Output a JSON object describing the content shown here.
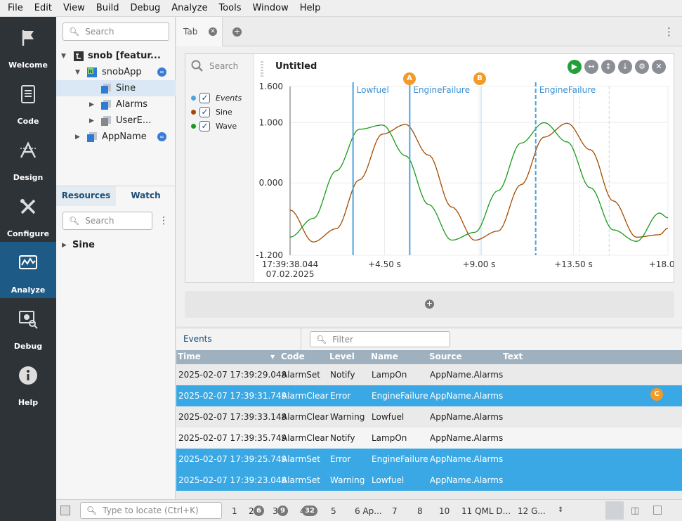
{
  "menu": [
    "File",
    "Edit",
    "View",
    "Build",
    "Debug",
    "Analyze",
    "Tools",
    "Window",
    "Help"
  ],
  "modes": [
    {
      "label": "Welcome",
      "icon": "flag-icon"
    },
    {
      "label": "Code",
      "icon": "document-icon"
    },
    {
      "label": "Design",
      "icon": "design-icon"
    },
    {
      "label": "Configure",
      "icon": "wrench-icon"
    },
    {
      "label": "Analyze",
      "icon": "analyze-icon",
      "active": true
    },
    {
      "label": "Debug",
      "icon": "debug-icon"
    },
    {
      "label": "Help",
      "icon": "info-icon"
    }
  ],
  "sidebar": {
    "search_placeholder": "Search",
    "tree": [
      {
        "label": "snob [featur...",
        "bold": true
      },
      {
        "label": "snobApp"
      },
      {
        "label": "Sine",
        "selected": true
      },
      {
        "label": "Alarms"
      },
      {
        "label": "UserE..."
      },
      {
        "label": "AppName"
      }
    ],
    "tabs": {
      "resources": "Resources",
      "watch": "Watch"
    },
    "resources_search_placeholder": "Search",
    "resources_item": "Sine"
  },
  "tabbar": {
    "tab_label": "Tab"
  },
  "plot": {
    "search_placeholder": "Search",
    "title": "Untitled",
    "legend": [
      {
        "label": "Events",
        "color": "#4aa3df"
      },
      {
        "label": "Sine",
        "color": "#a34b00"
      },
      {
        "label": "Wave",
        "color": "#1a9a1a"
      }
    ]
  },
  "chart_data": {
    "type": "line",
    "title": "Untitled",
    "y_ticks": [
      "1.600",
      "1.000",
      "0.000",
      "-1.200"
    ],
    "x_ticks": [
      "17:39:38.044",
      "+4.50 s",
      "+9.00 s",
      "+13.50 s",
      "+18.00 s"
    ],
    "x_start_date": "07.02.2025",
    "ylim": [
      -1.2,
      1.6
    ],
    "xlim": [
      0,
      18.0
    ],
    "series": [
      {
        "name": "Sine",
        "color": "#a34b00",
        "x": [
          0,
          1.1,
          2.2,
          3.3,
          4.4,
          5.5,
          6.6,
          7.7,
          8.8,
          9.9,
          11.0,
          12.1,
          13.2,
          14.3,
          15.4,
          16.5,
          17.6,
          18.0
        ],
        "y": [
          -0.45,
          -0.98,
          -0.76,
          0.05,
          0.81,
          0.97,
          0.46,
          -0.4,
          -0.95,
          -0.8,
          -0.03,
          0.76,
          0.99,
          0.55,
          -0.3,
          -0.9,
          -0.86,
          -0.75
        ]
      },
      {
        "name": "Wave",
        "color": "#1a9a1a",
        "x": [
          0,
          1.1,
          2.2,
          3.3,
          4.4,
          5.5,
          6.6,
          7.7,
          8.8,
          9.9,
          11.0,
          12.1,
          13.2,
          14.3,
          15.4,
          16.5,
          17.6,
          18.0
        ],
        "y": [
          -0.9,
          -0.59,
          0.2,
          0.89,
          0.96,
          0.45,
          -0.36,
          -0.95,
          -0.82,
          -0.13,
          0.66,
          1.0,
          0.68,
          -0.08,
          -0.78,
          -0.97,
          -0.5,
          -0.58
        ]
      }
    ],
    "events": [
      {
        "label": "Lowfuel",
        "x": 3.0
      },
      {
        "label": "EngineFailure",
        "x": 5.7
      },
      {
        "label": "EngineFailure",
        "x": 11.7
      }
    ],
    "markers": [
      {
        "label": "A",
        "x": 5.7
      },
      {
        "label": "B",
        "x": 9.1
      }
    ],
    "grid": true
  },
  "events_panel": {
    "title": "Events",
    "filter_placeholder": "Filter",
    "columns": [
      "Time",
      "Code",
      "Level",
      "Name",
      "Source",
      "Text"
    ],
    "rows": [
      {
        "time": "2025-02-07  17:39:29.048",
        "code": "AlarmSet",
        "level": "Notify",
        "name": "LampOn",
        "source": "AppName.Alarms",
        "selected": false
      },
      {
        "time": "2025-02-07  17:39:31.749",
        "code": "AlarmClear",
        "level": "Error",
        "name": "EngineFailure",
        "source": "AppName.Alarms",
        "selected": true
      },
      {
        "time": "2025-02-07  17:39:33.148",
        "code": "AlarmClear",
        "level": "Warning",
        "name": "Lowfuel",
        "source": "AppName.Alarms",
        "selected": false
      },
      {
        "time": "2025-02-07  17:39:35.749",
        "code": "AlarmClear",
        "level": "Notify",
        "name": "LampOn",
        "source": "AppName.Alarms",
        "selected": false
      },
      {
        "time": "2025-02-07  17:39:25.749",
        "code": "AlarmSet",
        "level": "Error",
        "name": "EngineFailure",
        "source": "AppName.Alarms",
        "selected": true
      },
      {
        "time": "2025-02-07  17:39:23.048",
        "code": "AlarmSet",
        "level": "Warning",
        "name": "Lowfuel",
        "source": "AppName.Alarms",
        "selected": true
      }
    ],
    "marker_c": "C"
  },
  "statusbar": {
    "locate_placeholder": "Type to locate (Ctrl+K)",
    "items": [
      "1",
      "2",
      "3",
      "4",
      "5",
      "6  Ap...",
      "7",
      "8",
      "10",
      "11  QML D...",
      "12  G..."
    ],
    "pills": [
      "6",
      "9",
      "32"
    ]
  }
}
